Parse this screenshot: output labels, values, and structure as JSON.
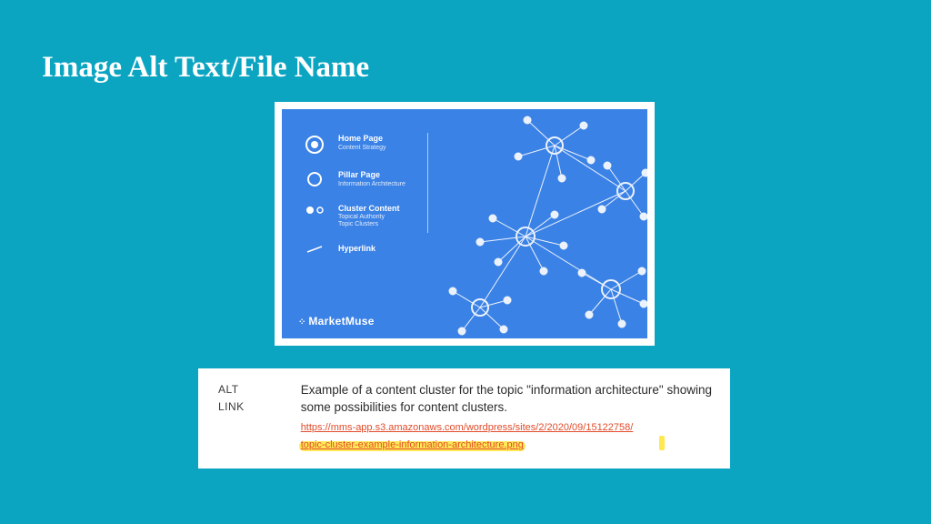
{
  "title": "Image Alt Text/File Name",
  "diagram": {
    "legend": [
      {
        "title": "Home Page",
        "sub": "Content Strategy"
      },
      {
        "title": "Pillar Page",
        "sub": "Information Architecture"
      },
      {
        "title": "Cluster Content",
        "sub": "Topical Authority\nTopic Clusters"
      },
      {
        "title": "Hyperlink",
        "sub": ""
      }
    ],
    "brand": "MarketMuse"
  },
  "alt_panel": {
    "label_alt": "ALT",
    "label_link": "LINK",
    "description": "Example of a content cluster for the topic \"information architecture\" showing some possibilities for content clusters.",
    "url_line1": "https://mms-app.s3.amazonaws.com/wordpress/sites/2/2020/09/15122758/",
    "url_line2": "topic-cluster-example-information-architecture.png"
  }
}
